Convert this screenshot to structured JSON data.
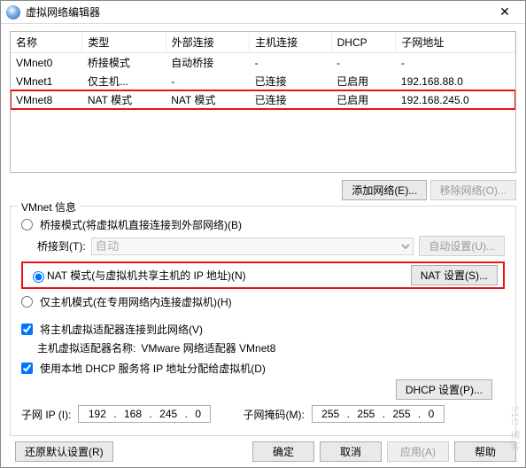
{
  "window": {
    "title": "虚拟网络编辑器"
  },
  "table": {
    "cols": [
      "名称",
      "类型",
      "外部连接",
      "主机连接",
      "DHCP",
      "子网地址"
    ],
    "rows": [
      {
        "name": "VMnet0",
        "type": "桥接模式",
        "ext": "自动桥接",
        "host": "-",
        "dhcp": "-",
        "subnet": "-",
        "selected": false
      },
      {
        "name": "VMnet1",
        "type": "仅主机...",
        "ext": "-",
        "host": "已连接",
        "dhcp": "已启用",
        "subnet": "192.168.88.0",
        "selected": false
      },
      {
        "name": "VMnet8",
        "type": "NAT 模式",
        "ext": "NAT 模式",
        "host": "已连接",
        "dhcp": "已启用",
        "subnet": "192.168.245.0",
        "selected": true
      }
    ]
  },
  "buttons": {
    "addNet": "添加网络(E)...",
    "removeNet": "移除网络(O)...",
    "autoCfg": "自动设置(U)...",
    "natCfg": "NAT 设置(S)...",
    "dhcpCfg": "DHCP 设置(P)...",
    "restore": "还原默认设置(R)",
    "ok": "确定",
    "cancel": "取消",
    "apply": "应用(A)",
    "help": "帮助"
  },
  "group": {
    "title": "VMnet 信息",
    "radio_bridge": "桥接模式(将虚拟机直接连接到外部网络)(B)",
    "bridgeTo_label": "桥接到(T):",
    "bridgeTo_value": "自动",
    "radio_nat": "NAT 模式(与虚拟机共享主机的 IP 地址)(N)",
    "radio_host": "仅主机模式(在专用网络内连接虚拟机)(H)",
    "chk_connect": "将主机虚拟适配器连接到此网络(V)",
    "adapter_prefix": "主机虚拟适配器名称: ",
    "adapter_name": "VMware 网络适配器 VMnet8",
    "chk_dhcp": "使用本地 DHCP 服务将 IP 地址分配给虚拟机(D)",
    "sub_ip_label": "子网 IP (I):",
    "sub_ip": [
      "192",
      "168",
      "245",
      "0"
    ],
    "mask_label": "子网掩码(M):",
    "mask": [
      "255",
      "255",
      "255",
      "0"
    ]
  },
  "watermark": "51C 博客"
}
